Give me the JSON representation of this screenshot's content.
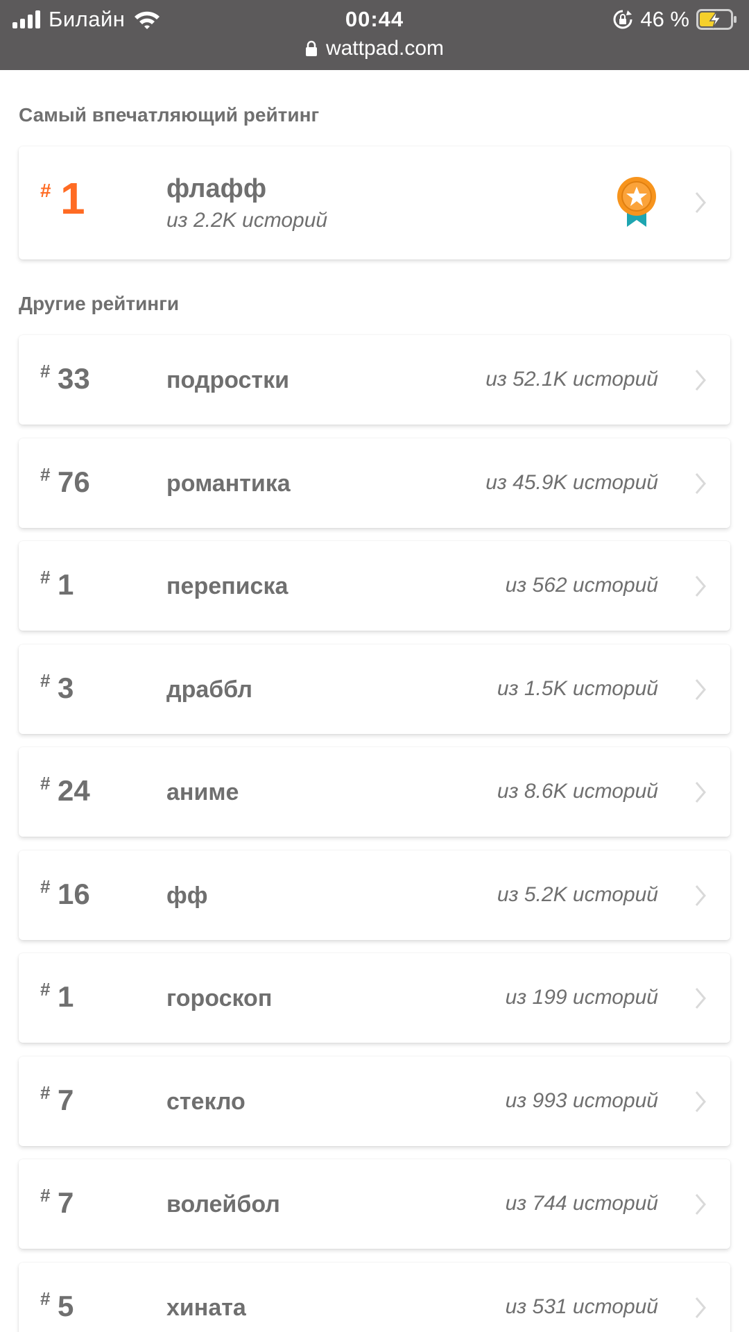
{
  "status_bar": {
    "carrier": "Билайн",
    "time": "00:44",
    "battery_percent": "46 %",
    "url": "wattpad.com",
    "icons": [
      "signal-icon",
      "wifi-icon",
      "rotation-lock-icon",
      "battery-charging-icon",
      "lock-icon"
    ]
  },
  "featured": {
    "section_title": "Самый впечатляющий рейтинг",
    "hash": "#",
    "rank": "1",
    "tag": "флафф",
    "count": "из 2.2K историй",
    "icon": "medal-icon",
    "accent_color": "#ff6b23"
  },
  "other": {
    "section_title": "Другие рейтинги",
    "items": [
      {
        "hash": "#",
        "rank": "33",
        "tag": "подростки",
        "count": "из 52.1K историй"
      },
      {
        "hash": "#",
        "rank": "76",
        "tag": "романтика",
        "count": "из 45.9K историй"
      },
      {
        "hash": "#",
        "rank": "1",
        "tag": "переписка",
        "count": "из 562 историй"
      },
      {
        "hash": "#",
        "rank": "3",
        "tag": "драббл",
        "count": "из 1.5K историй"
      },
      {
        "hash": "#",
        "rank": "24",
        "tag": "аниме",
        "count": "из 8.6K историй"
      },
      {
        "hash": "#",
        "rank": "16",
        "tag": "фф",
        "count": "из 5.2K историй"
      },
      {
        "hash": "#",
        "rank": "1",
        "tag": "гороскоп",
        "count": "из 199 историй"
      },
      {
        "hash": "#",
        "rank": "7",
        "tag": "стекло",
        "count": "из 993 историй"
      },
      {
        "hash": "#",
        "rank": "7",
        "tag": "волейбол",
        "count": "из 744 историй"
      },
      {
        "hash": "#",
        "rank": "5",
        "tag": "хината",
        "count": "из 531 историй"
      }
    ]
  },
  "colors": {
    "status_bar_bg": "#5c5a5b",
    "text": "#6f6f6f",
    "chevron": "#d9d9d9",
    "medal_orange": "#f7941d",
    "medal_ribbon": "#1ea5b0"
  }
}
